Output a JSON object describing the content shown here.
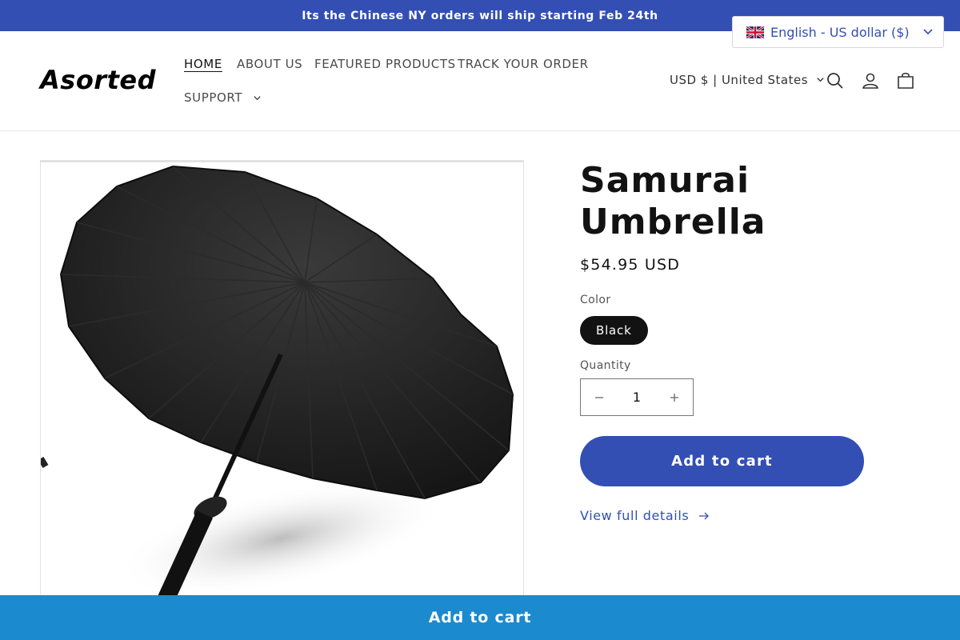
{
  "announcement": {
    "text": "Its the Chinese NY orders will ship starting Feb 24th"
  },
  "language_switcher": {
    "label": "English - US dollar ($)",
    "flag_icon": "uk-flag-icon"
  },
  "header": {
    "logo": "Asorted",
    "nav": [
      {
        "label": "HOME",
        "active": true
      },
      {
        "label": "ABOUT US"
      },
      {
        "label": "FEATURED PRODUCTS"
      },
      {
        "label": "TRACK YOUR ORDER"
      },
      {
        "label": "SUPPORT"
      }
    ],
    "currency": "USD $ | United States",
    "icons": [
      "search-icon",
      "account-icon",
      "cart-icon"
    ]
  },
  "product": {
    "title": "Samurai Umbrella",
    "price": "$54.95 USD",
    "color_label": "Color",
    "color_options": [
      "Black"
    ],
    "selected_color": "Black",
    "quantity_label": "Quantity",
    "quantity": "1",
    "add_to_cart": "Add to cart",
    "view_details": "View full details"
  },
  "sticky_bar": {
    "add_to_cart": "Add to cart"
  },
  "colors": {
    "brand": "#334fb4",
    "sticky": "#1b8ace",
    "text": "#121212"
  }
}
